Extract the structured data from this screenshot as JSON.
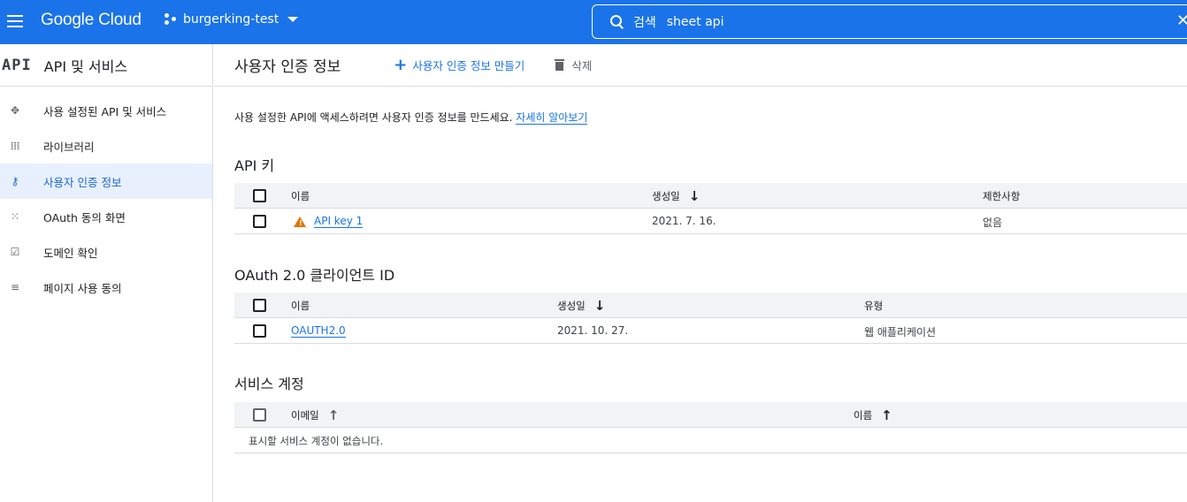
{
  "topbar": {
    "logo": "Google Cloud",
    "project": "burgerking-test",
    "search_placeholder": "검색",
    "search_value": "sheet api",
    "clear_label": "✕"
  },
  "sidebar": {
    "section_icon": "API",
    "section_title": "API 및 서비스",
    "items": [
      {
        "label": "사용 설정된 API 및 서비스",
        "icon": "enabled-apis-icon",
        "glyph": "✥"
      },
      {
        "label": "라이브러리",
        "icon": "library-icon",
        "glyph": "𝍖"
      },
      {
        "label": "사용자 인증 정보",
        "icon": "key-icon",
        "glyph": "⚷"
      },
      {
        "label": "OAuth 동의 화면",
        "icon": "oauth-consent-icon",
        "glyph": "⁙"
      },
      {
        "label": "도메인 확인",
        "icon": "domain-check-icon",
        "glyph": "☑"
      },
      {
        "label": "페이지 사용 동의",
        "icon": "page-usage-icon",
        "glyph": "≡"
      }
    ],
    "active_index": 2
  },
  "toolbar": {
    "page_title": "사용자 인증 정보",
    "create_label": "사용자 인증 정보 만들기",
    "delete_label": "삭제"
  },
  "description": {
    "text": "사용 설정한 API에 액세스하려면 사용자 인증 정보를 만드세요. ",
    "link": "자세히 알아보기"
  },
  "api_keys": {
    "title": "API 키",
    "columns": [
      "이름",
      "생성일",
      "제한사항"
    ],
    "rows": [
      {
        "name": "API key 1",
        "created": "2021. 7. 16.",
        "restriction": "없음",
        "warning": true
      }
    ]
  },
  "oauth": {
    "title": "OAuth 2.0 클라이언트 ID",
    "columns": [
      "이름",
      "생성일",
      "유형"
    ],
    "rows": [
      {
        "name": "OAUTH2.0",
        "created": "2021. 10. 27.",
        "type": "웹 애플리케이션"
      }
    ]
  },
  "service_accounts": {
    "title": "서비스 계정",
    "columns": [
      "이메일",
      "이름"
    ],
    "empty_text": "표시할 서비스 계정이 없습니다."
  },
  "colors": {
    "brand_blue": "#1a73e8",
    "active_bg": "#e8f0fe",
    "warning": "#e37400"
  }
}
